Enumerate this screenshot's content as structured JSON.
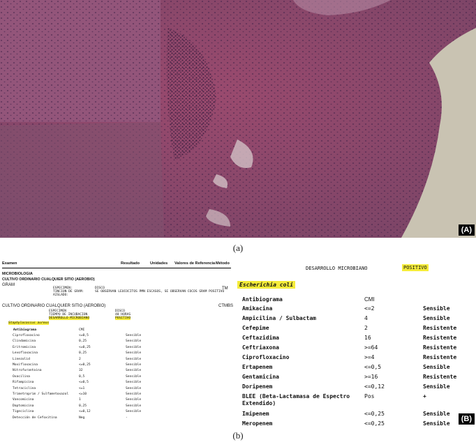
{
  "panel_a": {
    "label": "(A)",
    "caption": "(a)"
  },
  "panel_b": {
    "caption": "(b)",
    "label": "(B)",
    "left_report": {
      "headers": [
        "Examen",
        "Resultado",
        "Unidades",
        "Valores de Referencia",
        "Método"
      ],
      "section": "MICROBIOLOGIA",
      "culture1": "CULTIVO ORDINARIO CUALQUIER SITIO (AEROBIO)",
      "gram": "GRAM",
      "gram_method": "TM",
      "gram_spec": "ESPECIMEN:\nTINCION DE GRAM:\nAISLADO:",
      "gram_result": "DISCO\nSE OBSERVAN LEUCOCITOS PMN ESCASOS, SE OBSERVAN COCOS GRAM POSITIVO",
      "culture2": "CULTIVO ORDINARIO CUALQUIER SITIO (AEROBIO)",
      "culture2_method": "CTMBS",
      "c2_left_lines": [
        "ESPECIMEN",
        "TIEMPO DE INCUBACION",
        "DESARROLLO MICROBIANO"
      ],
      "c2_right_lines": [
        "DISCO",
        "48 HORAS",
        "POSITIVO"
      ],
      "species": "Staphylococcus aureus",
      "ab_head": "Antibiograma",
      "ab_cmi": "CMI",
      "rows": [
        {
          "drug": "Ciprofloxacino",
          "val": "<=0,5",
          "interp": "Sensible"
        },
        {
          "drug": "Clindamicina",
          "val": "0,25",
          "interp": "Sensible"
        },
        {
          "drug": "Eritromicina",
          "val": "<=0,25",
          "interp": "Sensible"
        },
        {
          "drug": "Levofloxacina",
          "val": "0,25",
          "interp": "Sensible"
        },
        {
          "drug": "Linezolid",
          "val": "2",
          "interp": "Sensible"
        },
        {
          "drug": "Moxifloxacina",
          "val": "<=0,25",
          "interp": "Sensible"
        },
        {
          "drug": "Nitrofurantoina",
          "val": "32",
          "interp": "Sensible"
        },
        {
          "drug": "Oxacilina",
          "val": "0,5",
          "interp": "Sensible"
        },
        {
          "drug": "Rifampicina",
          "val": "<=0,5",
          "interp": "Sensible"
        },
        {
          "drug": "Tetraciclina",
          "val": "<=1",
          "interp": "Sensible"
        },
        {
          "drug": "Trimetroprim / Sulfametoxazol",
          "val": "<=10",
          "interp": "Sensible"
        },
        {
          "drug": "Vancomicina",
          "val": "1",
          "interp": "Sensible"
        },
        {
          "drug": "Daptomicina",
          "val": "0,25",
          "interp": "Sensible"
        },
        {
          "drug": "Tigeciclina",
          "val": "<=0,12",
          "interp": "Sensible"
        },
        {
          "drug": "Detección de Cefoxitina",
          "val": "Neg",
          "interp": "-"
        }
      ]
    },
    "right_report": {
      "title": "DESARROLLO MICROBIANO",
      "result": "POSITIVO",
      "species": "Escherichia coli",
      "ab_head": "Antibiograma",
      "ab_cmi": "CMI",
      "rows": [
        {
          "drug": "Amikacina",
          "val": "<=2",
          "interp": "Sensible"
        },
        {
          "drug": "Ampicilina / Sulbactam",
          "val": "4",
          "interp": "Sensible"
        },
        {
          "drug": "Cefepime",
          "val": "2",
          "interp": "Resistente"
        },
        {
          "drug": "Ceftazidima",
          "val": "16",
          "interp": "Resistente"
        },
        {
          "drug": "Ceftriaxona",
          "val": ">=64",
          "interp": "Resistente"
        },
        {
          "drug": "Ciprofloxacino",
          "val": ">=4",
          "interp": "Resistente"
        },
        {
          "drug": "Ertapenem",
          "val": "<=0,5",
          "interp": "Sensible"
        },
        {
          "drug": "Gentamicina",
          "val": ">=16",
          "interp": "Resistente"
        },
        {
          "drug": "Doripenem",
          "val": "<=0,12",
          "interp": "Sensible"
        },
        {
          "drug": "BLEE (Beta-Lactamasa de Espectro",
          "drug2": "Extendido)",
          "val": "Pos",
          "interp": "+"
        },
        {
          "drug": "Imipenem",
          "val": "<=0,25",
          "interp": "Sensible"
        },
        {
          "drug": "Meropenem",
          "val": "<=0,25",
          "interp": "Sensible"
        }
      ]
    }
  }
}
